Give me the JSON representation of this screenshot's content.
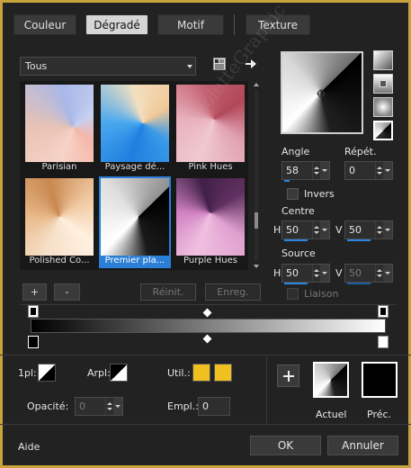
{
  "tabs": [
    {
      "label": "Couleur",
      "active": false
    },
    {
      "label": "Dégradé",
      "active": true
    },
    {
      "label": "Motif",
      "active": false
    },
    {
      "label": "Texture",
      "active": false
    }
  ],
  "category": {
    "value": "Tous"
  },
  "gradients": [
    {
      "label": "Parisian",
      "selected": false
    },
    {
      "label": "Paysage dé...",
      "selected": false
    },
    {
      "label": "Pink Hues",
      "selected": false
    },
    {
      "label": "Polished Co...",
      "selected": false
    },
    {
      "label": "Premier pla...",
      "selected": true
    },
    {
      "label": "Purple Hues",
      "selected": false
    }
  ],
  "list_buttons": {
    "add": "+",
    "remove": "-",
    "reset": "Réinit.",
    "save": "Enreg."
  },
  "angle": {
    "label": "Angle",
    "value": "58"
  },
  "repeat": {
    "label": "Répét.",
    "value": "0"
  },
  "invert": {
    "label": "Invers",
    "checked": false
  },
  "center": {
    "label": "Centre",
    "h_label": "H",
    "h_value": "50",
    "v_label": "V",
    "v_value": "50"
  },
  "source": {
    "label": "Source",
    "h_label": "H",
    "h_value": "50",
    "v_label": "V",
    "v_value": "50"
  },
  "link": {
    "label": "Liaison",
    "checked": false
  },
  "bottom": {
    "fg_label": "1pl:",
    "bg_label": "Arpl:",
    "use_label": "Util.:",
    "opacity_label": "Opacité:",
    "opacity_value": "0",
    "location_label": "Empl.:",
    "location_value": "0"
  },
  "previews": {
    "current_label": "Actuel",
    "previous_label": "Préc."
  },
  "footer": {
    "help": "Aide",
    "ok": "OK",
    "cancel": "Annuler"
  },
  "watermark": "VioletteGraphic",
  "colors": {
    "accent": "#2b86e0",
    "border": "#c8a23a",
    "swatch": "#f0c020"
  }
}
